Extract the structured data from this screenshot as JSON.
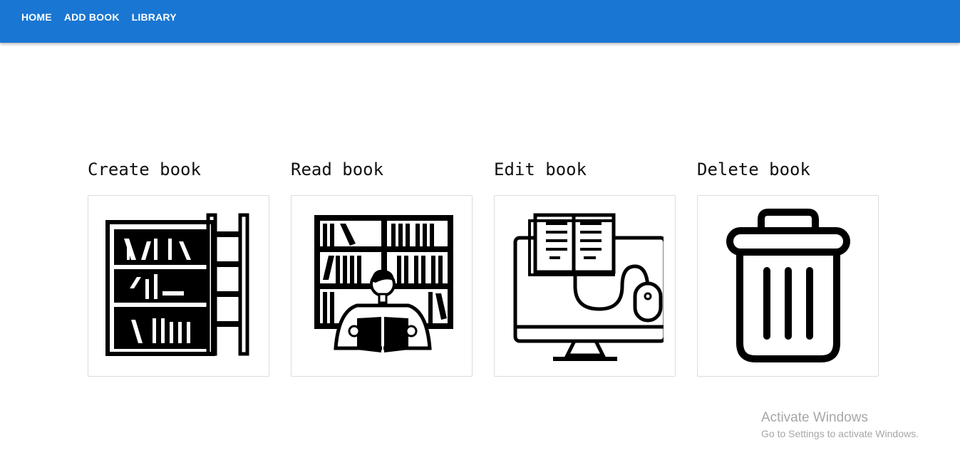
{
  "nav": {
    "items": [
      {
        "label": "HOME"
      },
      {
        "label": "ADD BOOK"
      },
      {
        "label": "LIBRARY"
      }
    ]
  },
  "cards": [
    {
      "title": "Create book",
      "icon": "bookshelf-ladder-icon"
    },
    {
      "title": "Read book",
      "icon": "person-reading-icon"
    },
    {
      "title": "Edit book",
      "icon": "monitor-book-mouse-icon"
    },
    {
      "title": "Delete book",
      "icon": "trash-can-icon"
    }
  ],
  "watermark": {
    "title": "Activate Windows",
    "subtitle": "Go to Settings to activate Windows."
  },
  "colors": {
    "navbar": "#1976d2",
    "nav_text": "#ffffff",
    "icon": "#000000"
  }
}
